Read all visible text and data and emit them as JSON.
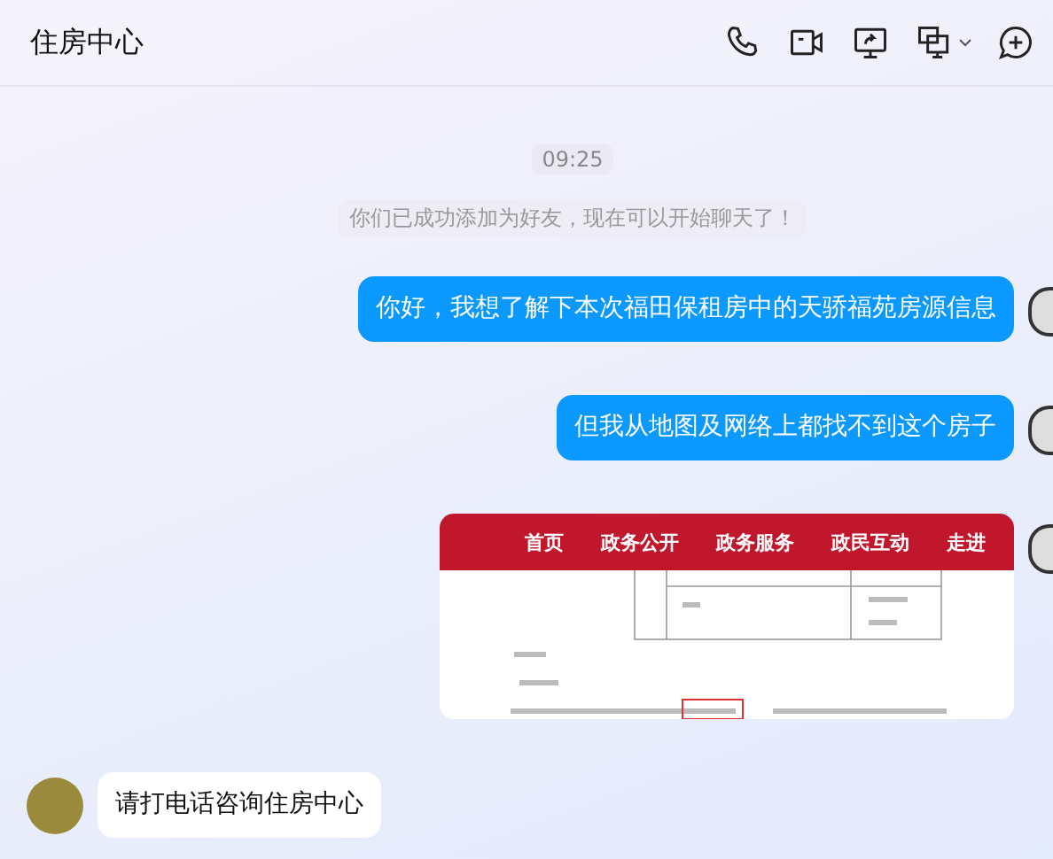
{
  "window": {
    "title": "住房中心"
  },
  "toolbar": [
    {
      "kind": "phone"
    },
    {
      "kind": "video"
    },
    {
      "kind": "share"
    },
    {
      "kind": "screen",
      "has_menu": true
    },
    {
      "kind": "add"
    }
  ],
  "messages": [
    {
      "kind": "time",
      "text": "09:25"
    },
    {
      "kind": "system",
      "text": "你们已成功添加为好友，现在可以开始聊天了！"
    },
    {
      "kind": "text",
      "outgoing": true,
      "text": "你好，我想了解下本次福田保租房中的天骄福苑房源信息"
    },
    {
      "kind": "text",
      "outgoing": true,
      "text": "但我从地图及网络上都找不到这个房子"
    },
    {
      "kind": "image",
      "outgoing": true,
      "nav": [
        "首页",
        "政务公开",
        "政务服务",
        "政民互动",
        "走进"
      ]
    },
    {
      "kind": "text",
      "outgoing": false,
      "text": "请打电话咨询住房中心"
    }
  ]
}
